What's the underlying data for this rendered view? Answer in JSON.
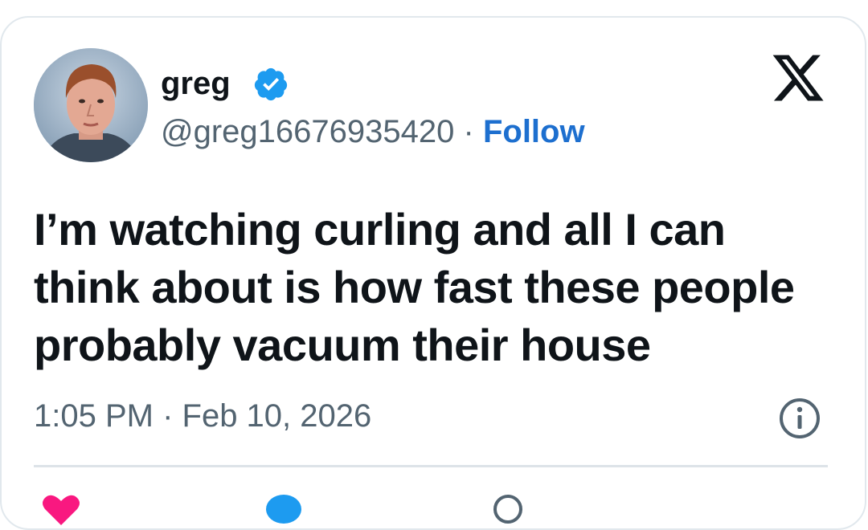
{
  "author": {
    "display_name": "greg",
    "handle": "@greg16676935420",
    "separator": "·",
    "follow_label": "Follow",
    "verified_color": "#1d9bf0"
  },
  "tweet": {
    "text": "I’m watching curling and all I can think about is how fast these people probably vacuum their house",
    "timestamp": "1:05 PM · Feb 10, 2026"
  },
  "icons": {
    "platform": "x-logo-icon",
    "info": "info-icon",
    "verified": "verified-badge-icon",
    "like": "heart-icon",
    "reply": "reply-icon",
    "copy_link": "link-icon"
  },
  "colors": {
    "text": "#0f1419",
    "muted": "#536471",
    "accent": "#1d6fcf",
    "like": "#f91880",
    "border": "#e1e8ed"
  }
}
